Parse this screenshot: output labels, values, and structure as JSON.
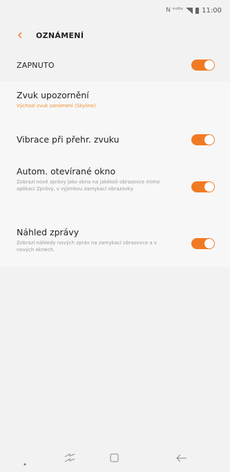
{
  "status_bar": {
    "time": "11:00",
    "icons": "N ᵛᵒˡᵗᵉ"
  },
  "header": {
    "title": "OZNÁMENÍ"
  },
  "master": {
    "label": "ZAPNUTO",
    "enabled": true
  },
  "settings": [
    {
      "title": "Zvuk upozornění",
      "subtitle": "Výchozí zvuk oznámení (Skyline)",
      "subtitle_color": "#f0902c",
      "has_toggle": false
    },
    {
      "title": "Vibrace při přehr. zvuku",
      "subtitle": "",
      "has_toggle": true,
      "enabled": true
    },
    {
      "title": "Autom. otevírané okno",
      "subtitle": "Zobrazí nové zprávy jako okna na jakékoli obrazovce mimo aplikaci Zprávy, s výjimkou zamykací obrazovky.",
      "has_toggle": true,
      "enabled": true
    },
    {
      "title": "Náhled zprávy",
      "subtitle": "Zobrazí náhledy nových zpráv na zamykací obrazovce a v nových oknech.",
      "has_toggle": true,
      "enabled": true
    }
  ],
  "colors": {
    "accent": "#f07a24",
    "background": "#f2f2f2",
    "card": "#f7f7f7"
  },
  "nav_icons": [
    "dot-icon",
    "recent-apps-icon",
    "home-icon",
    "back-arrow-icon"
  ]
}
